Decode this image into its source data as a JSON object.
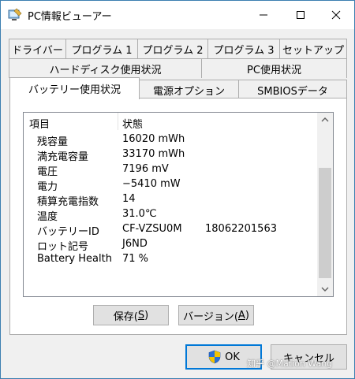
{
  "window": {
    "title": "PC情報ビューアー"
  },
  "tabs": {
    "row1": [
      "ドライバー",
      "プログラム 1",
      "プログラム 2",
      "プログラム 3",
      "セットアップ"
    ],
    "row2": [
      "ハードディスク使用状況",
      "PC使用状況"
    ],
    "row3": [
      "バッテリー使用状況",
      "電源オプション",
      "SMBIOSデータ"
    ]
  },
  "list": {
    "col_item": "項目",
    "col_status": "状態",
    "rows": [
      {
        "key": "残容量",
        "value": "16020 mWh",
        "extra": ""
      },
      {
        "key": "満充電容量",
        "value": "33170 mWh",
        "extra": ""
      },
      {
        "key": "電圧",
        "value": "7196 mV",
        "extra": ""
      },
      {
        "key": "電力",
        "value": "−5410 mW",
        "extra": ""
      },
      {
        "key": "積算充電指数",
        "value": "14",
        "extra": ""
      },
      {
        "key": "温度",
        "value": "31.0℃",
        "extra": ""
      },
      {
        "key": "バッテリーID",
        "value": "CF-VZSU0M",
        "extra": "18062201563"
      },
      {
        "key": "ロット記号",
        "value": "J6ND",
        "extra": ""
      },
      {
        "key": "Battery Health",
        "value": "71 %",
        "extra": ""
      }
    ]
  },
  "buttons": {
    "save_pre": "保存(",
    "save_key": "S",
    "save_post": ")",
    "version_pre": "バージョン(",
    "version_key": "A",
    "version_post": ")",
    "ok": "OK",
    "cancel": "キャンセル"
  },
  "watermark": "知乎 @Mation Wang"
}
